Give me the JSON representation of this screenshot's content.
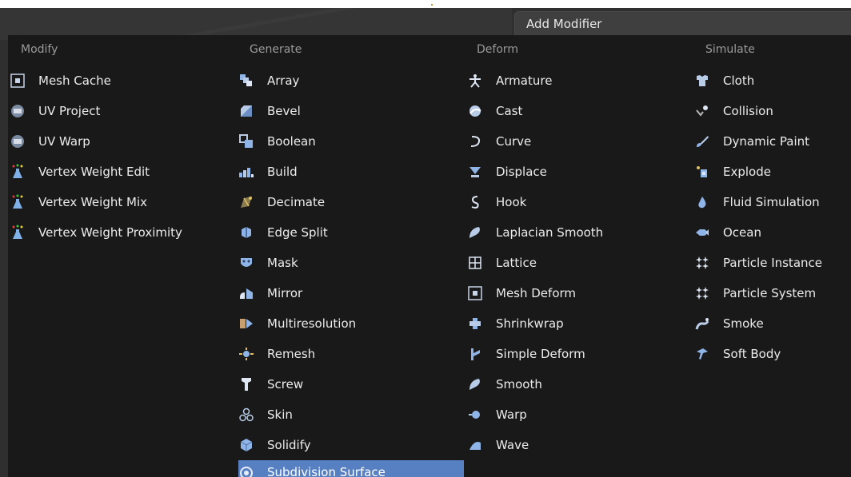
{
  "menu_title": "Add Modifier",
  "columns": {
    "modify": {
      "header": "Modify",
      "items": [
        {
          "label": "Mesh Cache",
          "icon": "mesh-cache-icon"
        },
        {
          "label": "UV Project",
          "icon": "uv-project-icon"
        },
        {
          "label": "UV Warp",
          "icon": "uv-warp-icon"
        },
        {
          "label": "Vertex Weight Edit",
          "icon": "vertex-weight-icon"
        },
        {
          "label": "Vertex Weight Mix",
          "icon": "vertex-weight-icon"
        },
        {
          "label": "Vertex Weight Proximity",
          "icon": "vertex-weight-icon"
        }
      ]
    },
    "generate": {
      "header": "Generate",
      "items": [
        {
          "label": "Array",
          "icon": "array-icon"
        },
        {
          "label": "Bevel",
          "icon": "bevel-icon"
        },
        {
          "label": "Boolean",
          "icon": "boolean-icon"
        },
        {
          "label": "Build",
          "icon": "build-icon"
        },
        {
          "label": "Decimate",
          "icon": "decimate-icon"
        },
        {
          "label": "Edge Split",
          "icon": "edge-split-icon"
        },
        {
          "label": "Mask",
          "icon": "mask-icon"
        },
        {
          "label": "Mirror",
          "icon": "mirror-icon"
        },
        {
          "label": "Multiresolution",
          "icon": "multiresolution-icon"
        },
        {
          "label": "Remesh",
          "icon": "remesh-icon"
        },
        {
          "label": "Screw",
          "icon": "screw-icon"
        },
        {
          "label": "Skin",
          "icon": "skin-icon"
        },
        {
          "label": "Solidify",
          "icon": "solidify-icon"
        },
        {
          "label": "Subdivision Surface",
          "icon": "subdivision-surface-icon",
          "highlighted": true
        }
      ]
    },
    "deform": {
      "header": "Deform",
      "items": [
        {
          "label": "Armature",
          "icon": "armature-icon"
        },
        {
          "label": "Cast",
          "icon": "cast-icon"
        },
        {
          "label": "Curve",
          "icon": "curve-icon"
        },
        {
          "label": "Displace",
          "icon": "displace-icon"
        },
        {
          "label": "Hook",
          "icon": "hook-icon"
        },
        {
          "label": "Laplacian Smooth",
          "icon": "laplacian-smooth-icon"
        },
        {
          "label": "Lattice",
          "icon": "lattice-icon"
        },
        {
          "label": "Mesh Deform",
          "icon": "mesh-deform-icon"
        },
        {
          "label": "Shrinkwrap",
          "icon": "shrinkwrap-icon"
        },
        {
          "label": "Simple Deform",
          "icon": "simple-deform-icon"
        },
        {
          "label": "Smooth",
          "icon": "smooth-icon"
        },
        {
          "label": "Warp",
          "icon": "warp-icon"
        },
        {
          "label": "Wave",
          "icon": "wave-icon"
        }
      ]
    },
    "simulate": {
      "header": "Simulate",
      "items": [
        {
          "label": "Cloth",
          "icon": "cloth-icon"
        },
        {
          "label": "Collision",
          "icon": "collision-icon"
        },
        {
          "label": "Dynamic Paint",
          "icon": "dynamic-paint-icon"
        },
        {
          "label": "Explode",
          "icon": "explode-icon"
        },
        {
          "label": "Fluid Simulation",
          "icon": "fluid-simulation-icon"
        },
        {
          "label": "Ocean",
          "icon": "ocean-icon"
        },
        {
          "label": "Particle Instance",
          "icon": "particle-instance-icon"
        },
        {
          "label": "Particle System",
          "icon": "particle-system-icon"
        },
        {
          "label": "Smoke",
          "icon": "smoke-icon"
        },
        {
          "label": "Soft Body",
          "icon": "soft-body-icon"
        }
      ]
    }
  },
  "colors": {
    "menu_bg": "#191919",
    "highlight": "#5680c2",
    "text": "#ececec",
    "header_text": "#9a9a9a"
  }
}
